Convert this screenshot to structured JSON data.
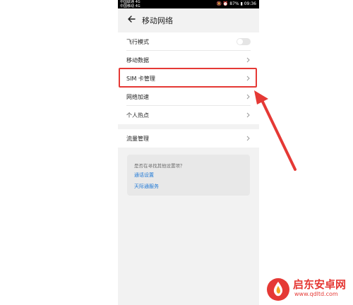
{
  "status_bar": {
    "left_line1": "中国联通 4G",
    "left_line2": "中国移动 4G",
    "right": "🔕 ⏰ 87% ▮ 09:36"
  },
  "header": {
    "title": "移动网络"
  },
  "settings": {
    "group1": [
      {
        "label": "飞行模式",
        "control": "toggle",
        "on": false
      },
      {
        "label": "移动数据",
        "control": "chevron"
      },
      {
        "label": "SIM 卡管理",
        "control": "chevron",
        "highlighted": true
      },
      {
        "label": "网络加速",
        "control": "chevron"
      },
      {
        "label": "个人热点",
        "control": "chevron"
      }
    ],
    "group2": [
      {
        "label": "流量管理",
        "control": "chevron"
      }
    ]
  },
  "suggestions": {
    "question": "是否在寻找其他设置项？",
    "links": [
      "通话设置",
      "天际通服务"
    ]
  },
  "watermark": {
    "name": "启东安卓网",
    "url": "www.qdltd.com"
  },
  "colors": {
    "accent_link": "#1e78d6",
    "highlight": "#e53935"
  }
}
